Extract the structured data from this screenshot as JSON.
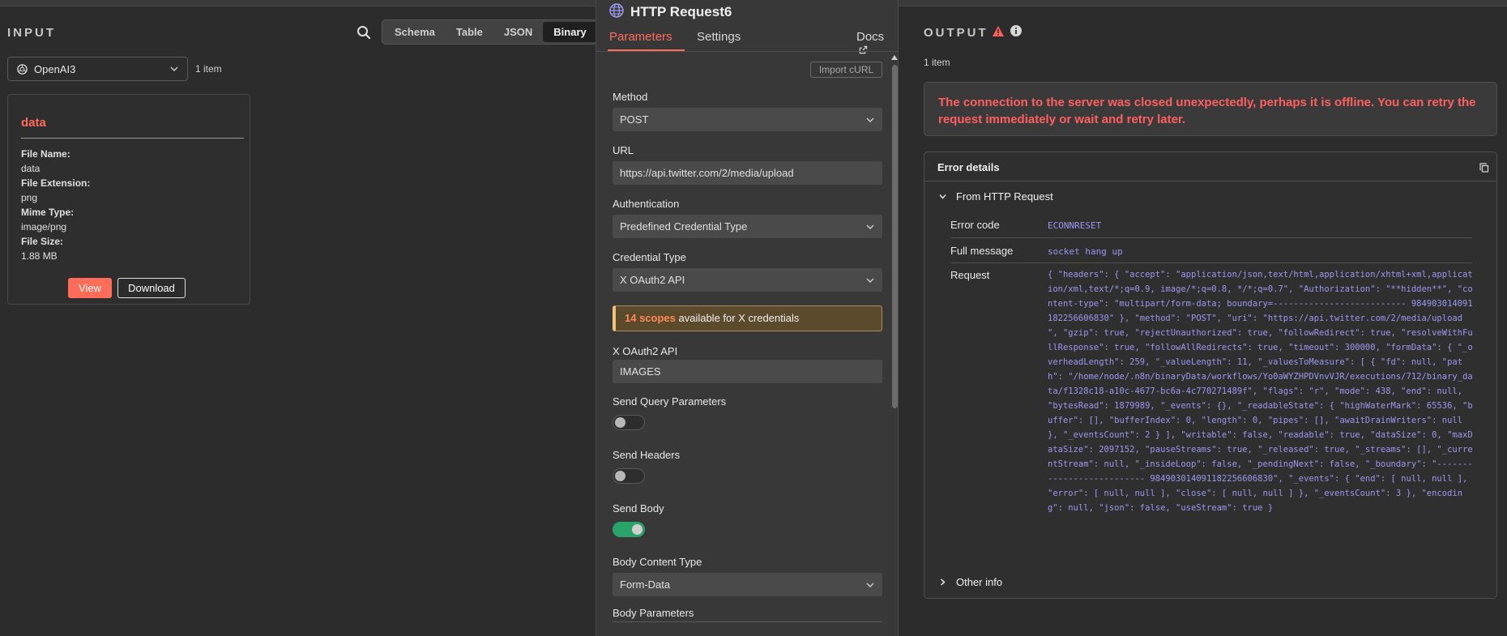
{
  "input": {
    "title": "INPUT",
    "tabs": [
      {
        "label": "Schema"
      },
      {
        "label": "Table"
      },
      {
        "label": "JSON"
      },
      {
        "label": "Binary",
        "active": true
      }
    ],
    "node_select": "OpenAI3",
    "item_count": "1 item",
    "card": {
      "title": "data",
      "fields": [
        {
          "key": "File Name:",
          "value": "data"
        },
        {
          "key": "File Extension:",
          "value": "png"
        },
        {
          "key": "Mime Type:",
          "value": "image/png"
        },
        {
          "key": "File Size:",
          "value": "1.88 MB"
        }
      ],
      "view_label": "View",
      "download_label": "Download"
    }
  },
  "node": {
    "title": "HTTP Request6",
    "tabs": {
      "parameters": "Parameters",
      "settings": "Settings",
      "docs": "Docs"
    },
    "import_curl": "Import cURL",
    "method": {
      "label": "Method",
      "value": "POST"
    },
    "url": {
      "label": "URL",
      "value": "https://api.twitter.com/2/media/upload"
    },
    "authentication": {
      "label": "Authentication",
      "value": "Predefined Credential Type"
    },
    "credential_type": {
      "label": "Credential Type",
      "value": "X OAuth2 API"
    },
    "notice": {
      "highlight": "14 scopes",
      "text": " available for X credentials"
    },
    "oauth": {
      "label": "X OAuth2 API",
      "value": "IMAGES"
    },
    "send_query": {
      "label": "Send Query Parameters",
      "on": false
    },
    "send_headers": {
      "label": "Send Headers",
      "on": false
    },
    "send_body": {
      "label": "Send Body",
      "on": true
    },
    "body_content_type": {
      "label": "Body Content Type",
      "value": "Form-Data"
    },
    "body_parameters": {
      "label": "Body Parameters"
    }
  },
  "output": {
    "title": "OUTPUT",
    "item_count": "1 item",
    "error_message": "The connection to the server was closed unexpectedly, perhaps it is offline. You can retry the request immediately or wait and retry later.",
    "details_title": "Error details",
    "from_section": "From HTTP Request",
    "rows": {
      "code_label": "Error code",
      "code_value": "ECONNRESET",
      "message_label": "Full message",
      "message_value": "socket hang up",
      "request_label": "Request",
      "request_value": "{ \"headers\": { \"accept\": \"application/json,text/html,application/xhtml+xml,application/xml,text/*;q=0.9, image/*;q=0.8, */*;q=0.7\", \"Authorization\": \"**hidden**\", \"content-type\": \"multipart/form-data; boundary=-------------------------- 984903014091182256606830\" }, \"method\": \"POST\", \"uri\": \"https://api.twitter.com/2/media/upload \", \"gzip\": true, \"rejectUnauthorized\": true, \"followRedirect\": true, \"resolveWithFullResponse\": true, \"followAllRedirects\": true, \"timeout\": 300000, \"formData\": { \"_overheadLength\": 259, \"_valueLength\": 11, \"_valuesToMeasure\": [ { \"fd\": null, \"path\": \"/home/node/.n8n/binaryData/workflows/Yo0aWYZHPDVnvVJR/executions/712/binary_data/f1328c18-a10c-4677-bc6a-4c770271489f\", \"flags\": \"r\", \"mode\": 438, \"end\": null, \"bytesRead\": 1879989, \"_events\": {}, \"_readableState\": { \"highWaterMark\": 65536, \"buffer\": [], \"bufferIndex\": 0, \"length\": 0, \"pipes\": [], \"awaitDrainWriters\": null }, \"_eventsCount\": 2 } ], \"writable\": false, \"readable\": true, \"dataSize\": 0, \"maxDataSize\": 2097152, \"pauseStreams\": true, \"_released\": true, \"_streams\": [], \"_currentStream\": null, \"_insideLoop\": false, \"_pendingNext\": false, \"_boundary\": \"-------------------------- 984903014091182256606830\", \"_events\": { \"end\": [ null, null ], \"error\": [ null, null ], \"close\": [ null, null ] }, \"_eventsCount\": 3 }, \"encoding\": null, \"json\": false, \"useStream\": true }"
    },
    "other_section": "Other info"
  },
  "colors": {
    "accent": "#ff6d5a",
    "error": "#ff5f5f",
    "success": "#29a36a",
    "code": "#9b98ee"
  }
}
